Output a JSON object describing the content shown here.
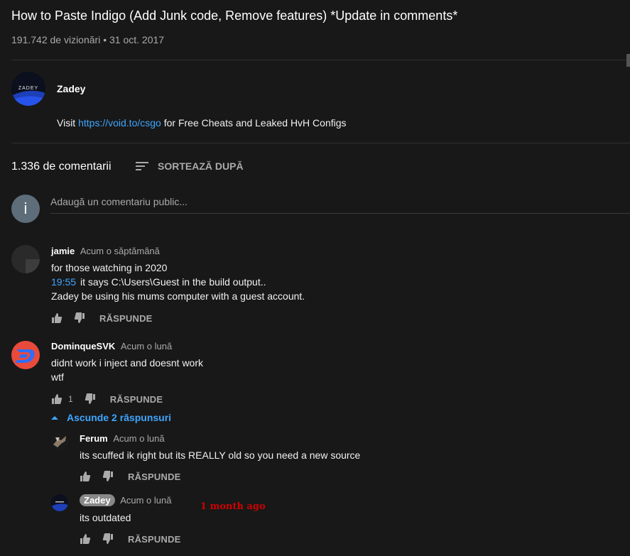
{
  "video": {
    "title": "How to Paste Indigo (Add Junk code, Remove features) *Update in comments*",
    "views": "191.742 de vizionări",
    "separator": "•",
    "date": "31 oct. 2017"
  },
  "channel": {
    "name": "Zadey",
    "avatar_text": "ZADEY",
    "description_prefix": "Visit ",
    "description_link": "https://void.to/csgo",
    "description_suffix": " for Free Cheats and Leaked HvH Configs"
  },
  "comments_header": {
    "count": "1.336 de comentarii",
    "sort_label": "SORTEAZĂ DUPĂ"
  },
  "add_comment": {
    "avatar_letter": "i",
    "placeholder": "Adaugă un comentariu public..."
  },
  "comments": [
    {
      "author": "jamie",
      "time": "Acum o săptămână",
      "timestamp_link": "19:55",
      "lines": [
        "for those watching in 2020",
        "it says C:\\Users\\Guest in the build output..",
        "Zadey be using his mums computer with a guest account."
      ],
      "reply_label": "RĂSPUNDE"
    },
    {
      "author": "DominqueSVK",
      "time": "Acum o lună",
      "lines": [
        "didnt work i inject and doesnt work",
        "wtf"
      ],
      "likes": "1",
      "reply_label": "RĂSPUNDE",
      "hide_replies_label": "Ascunde 2 răspunsuri",
      "replies": [
        {
          "author": "Ferum",
          "time": "Acum o lună",
          "text": "its scuffed ik right but its REALLY old so you need a new source",
          "reply_label": "RĂSPUNDE"
        },
        {
          "author": "Zadey",
          "time": "Acum o lună",
          "text": "its outdated",
          "reply_label": "RĂSPUNDE"
        }
      ]
    }
  ],
  "annotation": "1 month ago",
  "colors": {
    "background": "#181818",
    "link": "#3ea6ff",
    "secondary_text": "#aaaaaa",
    "annotation": "#d00000"
  }
}
